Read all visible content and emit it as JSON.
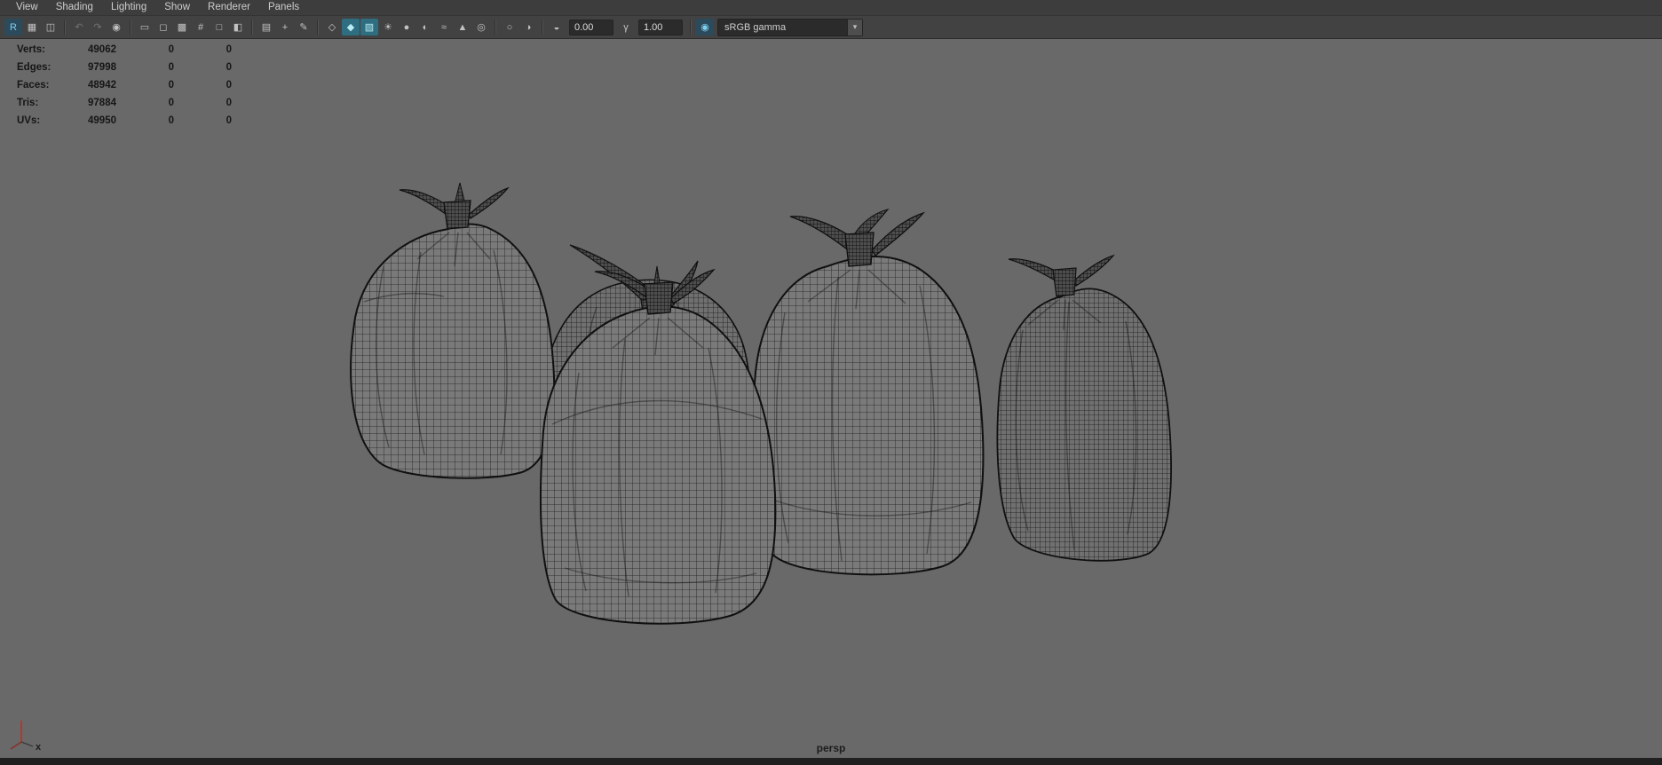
{
  "menu": {
    "items": [
      "View",
      "Shading",
      "Lighting",
      "Show",
      "Renderer",
      "Panels"
    ]
  },
  "toolbar": {
    "exposure_value": "0.00",
    "gamma_value": "1.00",
    "colorspace": "sRGB gamma",
    "items": [
      {
        "t": "icon",
        "n": "renderer-r",
        "g": "R",
        "accent": 1
      },
      {
        "t": "icon",
        "n": "shading-menu",
        "g": "▦"
      },
      {
        "t": "icon",
        "n": "panel-layout",
        "g": "◫"
      },
      {
        "t": "sep"
      },
      {
        "t": "icon",
        "n": "undo-view",
        "g": "↶",
        "dim": 1
      },
      {
        "t": "icon",
        "n": "redo-view",
        "g": "↷",
        "dim": 1
      },
      {
        "t": "icon",
        "n": "camera-select",
        "g": "◉"
      },
      {
        "t": "sep"
      },
      {
        "t": "icon",
        "n": "film-gate",
        "g": "▭"
      },
      {
        "t": "icon",
        "n": "resolution-gate",
        "g": "◻"
      },
      {
        "t": "icon",
        "n": "gate-mask",
        "g": "▩"
      },
      {
        "t": "icon",
        "n": "field-chart",
        "g": "#"
      },
      {
        "t": "icon",
        "n": "safe-action",
        "g": "□"
      },
      {
        "t": "icon",
        "n": "safe-title",
        "g": "◧"
      },
      {
        "t": "sep"
      },
      {
        "t": "icon",
        "n": "image-plane",
        "g": "▤"
      },
      {
        "t": "icon",
        "n": "pan-zoom-2d",
        "g": "+"
      },
      {
        "t": "icon",
        "n": "grease-pencil",
        "g": "✎"
      },
      {
        "t": "sep"
      },
      {
        "t": "icon",
        "n": "wireframe-mode",
        "g": "◇"
      },
      {
        "t": "icon",
        "n": "shaded-mode",
        "g": "◆",
        "active": 1
      },
      {
        "t": "icon",
        "n": "textured-mode",
        "g": "▧",
        "active": 1
      },
      {
        "t": "icon",
        "n": "use-all-lights",
        "g": "☀"
      },
      {
        "t": "icon",
        "n": "shadows",
        "g": "●"
      },
      {
        "t": "icon",
        "n": "screen-space-ao",
        "g": "◐"
      },
      {
        "t": "icon",
        "n": "motion-blur",
        "g": "≈"
      },
      {
        "t": "icon",
        "n": "anti-aliasing",
        "g": "▲"
      },
      {
        "t": "icon",
        "n": "depth-of-field",
        "g": "◎"
      },
      {
        "t": "sep"
      },
      {
        "t": "icon",
        "n": "isolate-select",
        "g": "○"
      },
      {
        "t": "icon",
        "n": "x-ray",
        "g": "◑"
      },
      {
        "t": "sep"
      },
      {
        "t": "icon",
        "n": "exposure",
        "g": "◒"
      },
      {
        "t": "field",
        "n": "exposure-value",
        "key": "exposure_value"
      },
      {
        "t": "icon",
        "n": "gamma",
        "g": "γ"
      },
      {
        "t": "field",
        "n": "gamma-value",
        "key": "gamma_value"
      },
      {
        "t": "sep"
      },
      {
        "t": "icon",
        "n": "view-transform",
        "g": "◉",
        "accent": 1
      },
      {
        "t": "select",
        "n": "colorspace-select",
        "key": "colorspace"
      }
    ]
  },
  "hud": {
    "rows": [
      {
        "label": "Verts:",
        "v1": "49062",
        "v2": "0",
        "v3": "0"
      },
      {
        "label": "Edges:",
        "v1": "97998",
        "v2": "0",
        "v3": "0"
      },
      {
        "label": "Faces:",
        "v1": "48942",
        "v2": "0",
        "v3": "0"
      },
      {
        "label": "Tris:",
        "v1": "97884",
        "v2": "0",
        "v3": "0"
      },
      {
        "label": "UVs:",
        "v1": "49950",
        "v2": "0",
        "v3": "0"
      }
    ]
  },
  "viewport": {
    "camera_label": "persp",
    "axis_label": "x"
  },
  "colors": {
    "viewport_bg": "#696969",
    "toolbar_bg": "#424242",
    "menu_bg": "#3d3d3d",
    "active_icon_bg": "#2e6e80",
    "axis_x": "#b03a2e",
    "wireframe": "#1d1d1d"
  }
}
